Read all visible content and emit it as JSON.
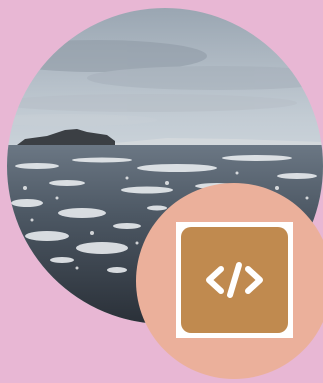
{
  "colors": {
    "background": "#e8b7d4",
    "badge": "#ebb09b",
    "icon_tile": "#c08a4f",
    "icon_frame": "#ffffff",
    "icon_glyph": "#ffffff",
    "sky_top": "#bcc5cc",
    "sea": "#3c4650"
  },
  "photo": {
    "subject": "polar-sea-with-ice-floes"
  },
  "badge": {
    "icon": "code-brackets-icon"
  }
}
